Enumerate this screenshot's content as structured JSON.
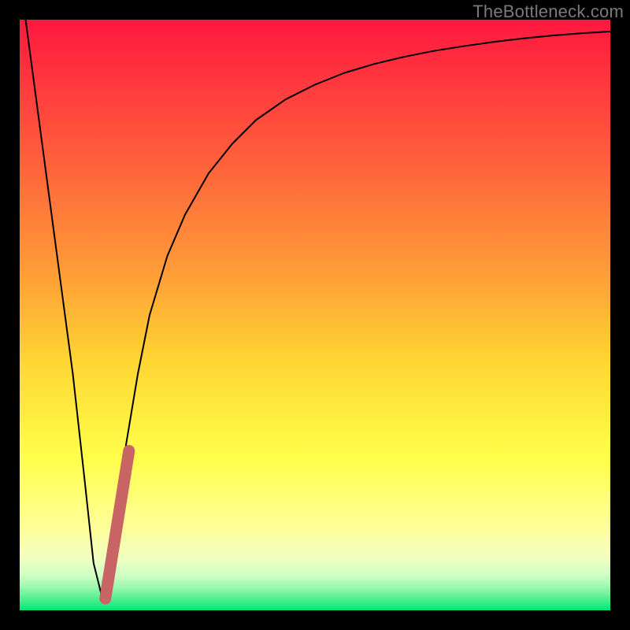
{
  "watermark": "TheBottleneck.com",
  "colors": {
    "frame": "#000000",
    "curve": "#000000",
    "marker": "#c86464",
    "gradient_top": "#ff183f",
    "gradient_mid_upper": "#ff7b3a",
    "gradient_mid": "#ffd633",
    "gradient_mid_lower": "#ffff55",
    "gradient_lower": "#ffffa0",
    "gradient_near_bottom": "#d8ffb0",
    "gradient_bottom": "#00e874"
  },
  "chart_data": {
    "type": "line",
    "title": "",
    "xlabel": "",
    "ylabel": "",
    "xlim": [
      0,
      100
    ],
    "ylim": [
      0,
      100
    ],
    "grid": false,
    "legend": false,
    "annotations": [],
    "series": [
      {
        "name": "bottleneck-curve",
        "x": [
          1,
          3,
          5,
          7,
          9,
          11,
          12.5,
          14,
          16,
          18,
          20,
          22,
          25,
          28,
          32,
          36,
          40,
          45,
          50,
          55,
          60,
          65,
          70,
          75,
          80,
          85,
          90,
          95,
          100
        ],
        "y": [
          100,
          85,
          70,
          55,
          40,
          22,
          8,
          2,
          12,
          28,
          40,
          50,
          60,
          67,
          74,
          79,
          83,
          86.5,
          89,
          91,
          92.5,
          93.7,
          94.7,
          95.5,
          96.2,
          96.8,
          97.3,
          97.7,
          98
        ]
      },
      {
        "name": "marker-segment",
        "x": [
          14.5,
          18.5
        ],
        "y": [
          2,
          27
        ]
      }
    ],
    "minimum_point": {
      "x": 13.5,
      "y": 1
    }
  }
}
